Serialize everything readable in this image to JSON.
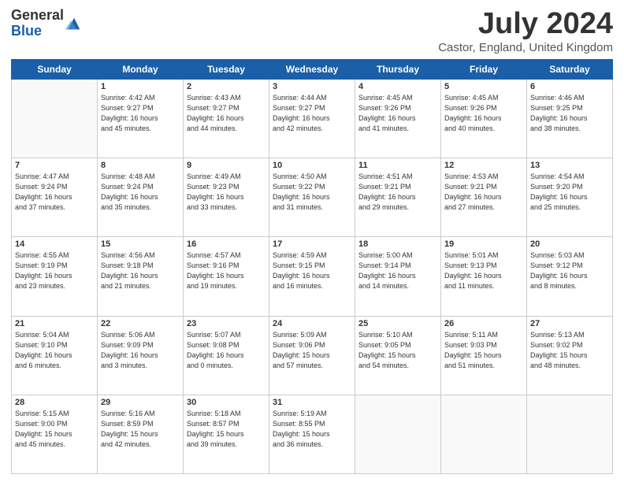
{
  "header": {
    "logo_general": "General",
    "logo_blue": "Blue",
    "month_title": "July 2024",
    "location": "Castor, England, United Kingdom"
  },
  "days_of_week": [
    "Sunday",
    "Monday",
    "Tuesday",
    "Wednesday",
    "Thursday",
    "Friday",
    "Saturday"
  ],
  "weeks": [
    [
      {
        "day": "",
        "info": ""
      },
      {
        "day": "1",
        "info": "Sunrise: 4:42 AM\nSunset: 9:27 PM\nDaylight: 16 hours\nand 45 minutes."
      },
      {
        "day": "2",
        "info": "Sunrise: 4:43 AM\nSunset: 9:27 PM\nDaylight: 16 hours\nand 44 minutes."
      },
      {
        "day": "3",
        "info": "Sunrise: 4:44 AM\nSunset: 9:27 PM\nDaylight: 16 hours\nand 42 minutes."
      },
      {
        "day": "4",
        "info": "Sunrise: 4:45 AM\nSunset: 9:26 PM\nDaylight: 16 hours\nand 41 minutes."
      },
      {
        "day": "5",
        "info": "Sunrise: 4:45 AM\nSunset: 9:26 PM\nDaylight: 16 hours\nand 40 minutes."
      },
      {
        "day": "6",
        "info": "Sunrise: 4:46 AM\nSunset: 9:25 PM\nDaylight: 16 hours\nand 38 minutes."
      }
    ],
    [
      {
        "day": "7",
        "info": "Sunrise: 4:47 AM\nSunset: 9:24 PM\nDaylight: 16 hours\nand 37 minutes."
      },
      {
        "day": "8",
        "info": "Sunrise: 4:48 AM\nSunset: 9:24 PM\nDaylight: 16 hours\nand 35 minutes."
      },
      {
        "day": "9",
        "info": "Sunrise: 4:49 AM\nSunset: 9:23 PM\nDaylight: 16 hours\nand 33 minutes."
      },
      {
        "day": "10",
        "info": "Sunrise: 4:50 AM\nSunset: 9:22 PM\nDaylight: 16 hours\nand 31 minutes."
      },
      {
        "day": "11",
        "info": "Sunrise: 4:51 AM\nSunset: 9:21 PM\nDaylight: 16 hours\nand 29 minutes."
      },
      {
        "day": "12",
        "info": "Sunrise: 4:53 AM\nSunset: 9:21 PM\nDaylight: 16 hours\nand 27 minutes."
      },
      {
        "day": "13",
        "info": "Sunrise: 4:54 AM\nSunset: 9:20 PM\nDaylight: 16 hours\nand 25 minutes."
      }
    ],
    [
      {
        "day": "14",
        "info": "Sunrise: 4:55 AM\nSunset: 9:19 PM\nDaylight: 16 hours\nand 23 minutes."
      },
      {
        "day": "15",
        "info": "Sunrise: 4:56 AM\nSunset: 9:18 PM\nDaylight: 16 hours\nand 21 minutes."
      },
      {
        "day": "16",
        "info": "Sunrise: 4:57 AM\nSunset: 9:16 PM\nDaylight: 16 hours\nand 19 minutes."
      },
      {
        "day": "17",
        "info": "Sunrise: 4:59 AM\nSunset: 9:15 PM\nDaylight: 16 hours\nand 16 minutes."
      },
      {
        "day": "18",
        "info": "Sunrise: 5:00 AM\nSunset: 9:14 PM\nDaylight: 16 hours\nand 14 minutes."
      },
      {
        "day": "19",
        "info": "Sunrise: 5:01 AM\nSunset: 9:13 PM\nDaylight: 16 hours\nand 11 minutes."
      },
      {
        "day": "20",
        "info": "Sunrise: 5:03 AM\nSunset: 9:12 PM\nDaylight: 16 hours\nand 8 minutes."
      }
    ],
    [
      {
        "day": "21",
        "info": "Sunrise: 5:04 AM\nSunset: 9:10 PM\nDaylight: 16 hours\nand 6 minutes."
      },
      {
        "day": "22",
        "info": "Sunrise: 5:06 AM\nSunset: 9:09 PM\nDaylight: 16 hours\nand 3 minutes."
      },
      {
        "day": "23",
        "info": "Sunrise: 5:07 AM\nSunset: 9:08 PM\nDaylight: 16 hours\nand 0 minutes."
      },
      {
        "day": "24",
        "info": "Sunrise: 5:09 AM\nSunset: 9:06 PM\nDaylight: 15 hours\nand 57 minutes."
      },
      {
        "day": "25",
        "info": "Sunrise: 5:10 AM\nSunset: 9:05 PM\nDaylight: 15 hours\nand 54 minutes."
      },
      {
        "day": "26",
        "info": "Sunrise: 5:11 AM\nSunset: 9:03 PM\nDaylight: 15 hours\nand 51 minutes."
      },
      {
        "day": "27",
        "info": "Sunrise: 5:13 AM\nSunset: 9:02 PM\nDaylight: 15 hours\nand 48 minutes."
      }
    ],
    [
      {
        "day": "28",
        "info": "Sunrise: 5:15 AM\nSunset: 9:00 PM\nDaylight: 15 hours\nand 45 minutes."
      },
      {
        "day": "29",
        "info": "Sunrise: 5:16 AM\nSunset: 8:59 PM\nDaylight: 15 hours\nand 42 minutes."
      },
      {
        "day": "30",
        "info": "Sunrise: 5:18 AM\nSunset: 8:57 PM\nDaylight: 15 hours\nand 39 minutes."
      },
      {
        "day": "31",
        "info": "Sunrise: 5:19 AM\nSunset: 8:55 PM\nDaylight: 15 hours\nand 36 minutes."
      },
      {
        "day": "",
        "info": ""
      },
      {
        "day": "",
        "info": ""
      },
      {
        "day": "",
        "info": ""
      }
    ]
  ]
}
